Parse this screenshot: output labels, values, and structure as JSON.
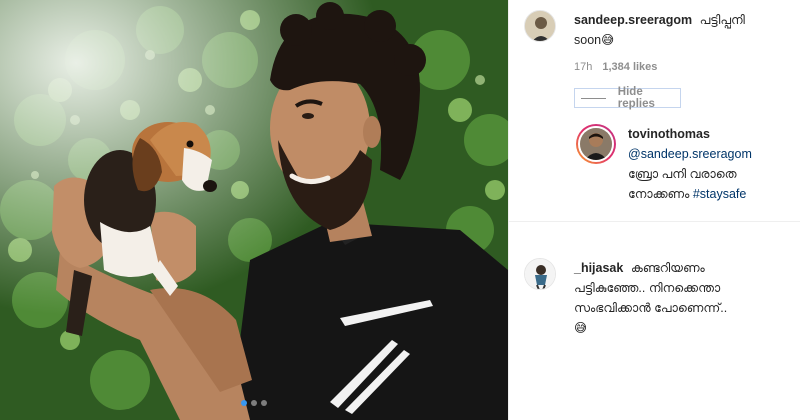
{
  "colors": {
    "link": "#003569",
    "meta": "#8e8e8e",
    "text": "#262626",
    "active_dot": "#3897f0"
  },
  "post": {
    "carousel_dots": 3,
    "active_dot": 1
  },
  "comments": [
    {
      "username": "sandeep.sreeragom",
      "text_line1": "പട്ടിപ്പനി",
      "text_line2": "soon",
      "emoji": "😅",
      "time": "17h",
      "likes": "1,384 likes",
      "hide_replies_label": "Hide replies"
    },
    {
      "username": "tovinothomas",
      "mention": "@sandeep.sreeragom",
      "text_line1": "ബ്രോ പനി വരാതെ",
      "text_line2": "നോക്കണം",
      "hashtag": "#staysafe"
    },
    {
      "username": "_hijasak",
      "text_line1": "കണ്ടറിയണം",
      "text_line2": "പട്ടികുഞ്ഞേ.. നിനക്കെന്താ",
      "text_line3": "സംഭവിക്കാൻ പോണെന്ന്..",
      "emoji": "😅"
    }
  ]
}
